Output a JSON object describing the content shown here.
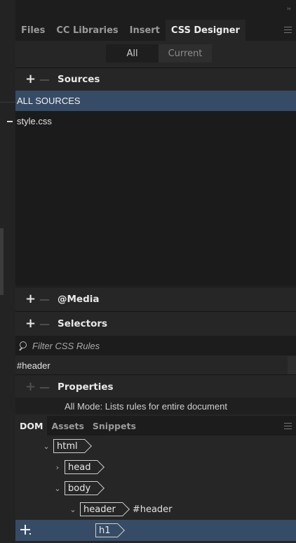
{
  "tabs": [
    {
      "label": "Files",
      "active": false
    },
    {
      "label": "CC Libraries",
      "active": false
    },
    {
      "label": "Insert",
      "active": false
    },
    {
      "label": "CSS Designer",
      "active": true
    }
  ],
  "overflow_icon": "double-chevron-right-icon",
  "mode": {
    "all": "All",
    "current": "Current",
    "selected": "All"
  },
  "sources": {
    "title": "Sources",
    "add": "+",
    "remove": "—",
    "items": [
      {
        "label": "ALL SOURCES",
        "selected": true
      },
      {
        "label": "style.css",
        "selected": false
      }
    ]
  },
  "media": {
    "title": "@Media",
    "add": "+",
    "remove": "—"
  },
  "selectors": {
    "title": "Selectors",
    "add": "+",
    "remove": "—",
    "filter_placeholder": "Filter CSS Rules",
    "items": [
      "#header"
    ]
  },
  "properties": {
    "title": "Properties",
    "add": "+",
    "remove": "—",
    "info": "All Mode: Lists rules for entire document"
  },
  "dom_panel": {
    "tabs": [
      {
        "label": "DOM",
        "active": true
      },
      {
        "label": "Assets",
        "active": false
      },
      {
        "label": "Snippets",
        "active": false
      }
    ],
    "tree": [
      {
        "tag": "html",
        "twisty": "⌄",
        "extra": ""
      },
      {
        "tag": "head",
        "twisty": "›",
        "extra": ""
      },
      {
        "tag": "body",
        "twisty": "⌄",
        "extra": ""
      },
      {
        "tag": "header",
        "twisty": "⌄",
        "extra": "#header"
      },
      {
        "tag": "h1",
        "twisty": "",
        "extra": "",
        "selected": true
      }
    ]
  },
  "colors": {
    "selection": "#364c66",
    "panel_bg": "#262626",
    "list_bg": "#1b1b1b"
  }
}
